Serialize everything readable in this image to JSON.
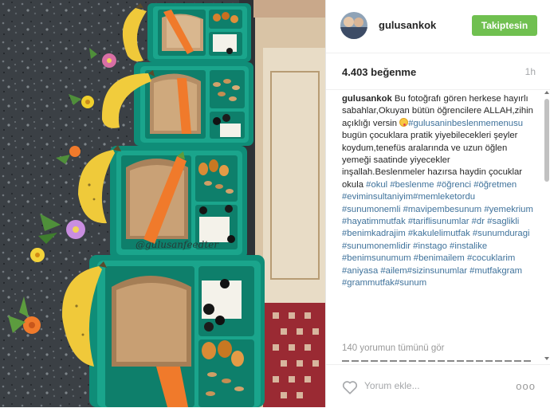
{
  "photo": {
    "alt": "Lunch boxes with bread, carrots, cheese, olives, nuts and bananas",
    "watermark": "@gulusanfeedter"
  },
  "header": {
    "username": "gulusankok",
    "follow_label": "Takiptesin"
  },
  "stats": {
    "likes": "4.403 beğenme",
    "time": "1h"
  },
  "caption": {
    "username": "gulusankok",
    "parts": [
      {
        "t": "text",
        "v": " Bu fotoğrafı gören herkese hayırlı sabahlar,Okuyan bütün öğrencilere ALLAH,zihin açıklığı versin "
      },
      {
        "t": "emoji",
        "v": "yum-emoji"
      },
      {
        "t": "tag",
        "v": "#gulusaninbeslenmemenusu"
      },
      {
        "t": "text",
        "v": " bugün çocuklara pratik yiyebilecekleri şeyler koydum,tenefüs aralarında ve uzun öğlen yemeği saatinde yiyecekler inşallah.Beslenmeler hazırsa haydin çocuklar okula "
      },
      {
        "t": "tag",
        "v": "#okul"
      },
      {
        "t": "text",
        "v": " "
      },
      {
        "t": "tag",
        "v": "#beslenme"
      },
      {
        "t": "text",
        "v": " "
      },
      {
        "t": "tag",
        "v": "#öğrenci"
      },
      {
        "t": "text",
        "v": " "
      },
      {
        "t": "tag",
        "v": "#öğretmen"
      },
      {
        "t": "text",
        "v": " "
      },
      {
        "t": "tag",
        "v": "#eviminsultaniyim"
      },
      {
        "t": "tag",
        "v": "#memleketordu"
      },
      {
        "t": "text",
        "v": " "
      },
      {
        "t": "tag",
        "v": "#sunumonemli"
      },
      {
        "t": "text",
        "v": " "
      },
      {
        "t": "tag",
        "v": "#mavipembesunum"
      },
      {
        "t": "text",
        "v": " "
      },
      {
        "t": "tag",
        "v": "#yemekrium"
      },
      {
        "t": "text",
        "v": " "
      },
      {
        "t": "tag",
        "v": "#hayatimmutfak"
      },
      {
        "t": "text",
        "v": " "
      },
      {
        "t": "tag",
        "v": "#tariflisunumlar"
      },
      {
        "t": "text",
        "v": " "
      },
      {
        "t": "tag",
        "v": "#dr"
      },
      {
        "t": "text",
        "v": " "
      },
      {
        "t": "tag",
        "v": "#saglikli"
      },
      {
        "t": "text",
        "v": " "
      },
      {
        "t": "tag",
        "v": "#benimkadrajim"
      },
      {
        "t": "text",
        "v": " "
      },
      {
        "t": "tag",
        "v": "#kakulelimutfak"
      },
      {
        "t": "text",
        "v": " "
      },
      {
        "t": "tag",
        "v": "#sunumduragi"
      },
      {
        "t": "text",
        "v": " "
      },
      {
        "t": "tag",
        "v": "#sunumonemlidir"
      },
      {
        "t": "text",
        "v": " "
      },
      {
        "t": "tag",
        "v": "#instago"
      },
      {
        "t": "text",
        "v": " "
      },
      {
        "t": "tag",
        "v": "#instalike"
      },
      {
        "t": "text",
        "v": " "
      },
      {
        "t": "tag",
        "v": "#benimsunumum"
      },
      {
        "t": "text",
        "v": " "
      },
      {
        "t": "tag",
        "v": "#benimailem"
      },
      {
        "t": "text",
        "v": " "
      },
      {
        "t": "tag",
        "v": "#cocuklarim"
      },
      {
        "t": "text",
        "v": " "
      },
      {
        "t": "tag",
        "v": "#aniyasa"
      },
      {
        "t": "text",
        "v": " "
      },
      {
        "t": "tag",
        "v": "#ailem"
      },
      {
        "t": "tag",
        "v": "#sizinsunumlar"
      },
      {
        "t": "text",
        "v": " "
      },
      {
        "t": "tag",
        "v": "#mutfakgram"
      },
      {
        "t": "text",
        "v": " "
      },
      {
        "t": "tag",
        "v": "#grammutfak"
      },
      {
        "t": "tag",
        "v": "#sunum"
      }
    ]
  },
  "comments_link": "140 yorumun tümünü gör",
  "comment_bar": {
    "like_icon": "heart-icon",
    "placeholder": "Yorum ekle...",
    "more_label": "ooo"
  },
  "colors": {
    "follow_button": "#70c050",
    "hashtag": "#3f729b",
    "box_green": "#1aa58c"
  }
}
